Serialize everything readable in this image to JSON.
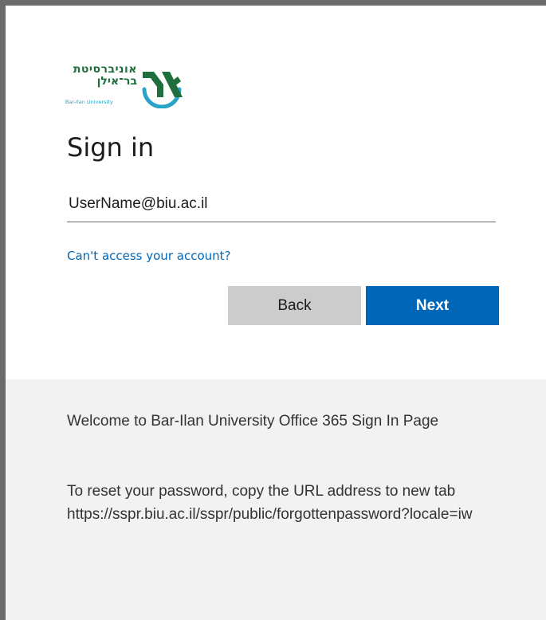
{
  "logo": {
    "hebrew_line1": "אוניברסיטת",
    "hebrew_line2": "בר־אילן",
    "english": "Bar-Ilan University",
    "colors": {
      "green": "#1f6f3c",
      "blue": "#2aa3c9"
    }
  },
  "signin": {
    "title": "Sign in",
    "email_value": "UserName@biu.ac.il",
    "cant_access_link": "Can't access your account?",
    "back_label": "Back",
    "next_label": "Next"
  },
  "footer": {
    "welcome": "Welcome to Bar-Ilan University Office 365 Sign In Page",
    "reset_line1": "To reset your password, copy the URL address to new tab",
    "reset_line2": "https://sspr.biu.ac.il/sspr/public/forgottenpassword?locale=iw"
  },
  "colors": {
    "accent": "#0067b8",
    "back_button": "#cccccc",
    "footer_bg": "#f2f2f2"
  }
}
